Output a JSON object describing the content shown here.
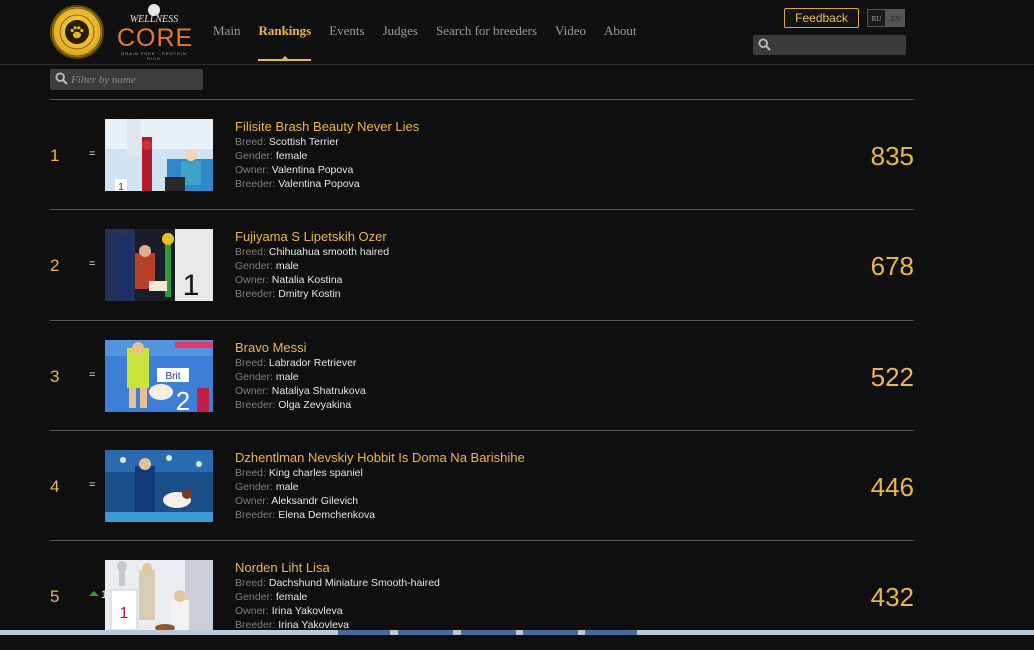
{
  "header": {
    "logo_best_dog_text": "BEST RUSSIAN DOG",
    "logo_wellness_text": "WELLNESS",
    "logo_core_text": "CORE",
    "logo_core_sub": "GRAIN FREE · PROTEIN RICH",
    "nav": [
      {
        "label": "Main",
        "active": false
      },
      {
        "label": "Rankings",
        "active": true
      },
      {
        "label": "Events",
        "active": false
      },
      {
        "label": "Judges",
        "active": false
      },
      {
        "label": "Search for breeders",
        "active": false
      },
      {
        "label": "Video",
        "active": false
      },
      {
        "label": "About",
        "active": false
      }
    ],
    "feedback_label": "Feedback",
    "lang_ru": "RU",
    "lang_en": "EN",
    "search_placeholder": ""
  },
  "filter": {
    "placeholder": "Filter by name"
  },
  "labels": {
    "breed": "Breed:",
    "gender": "Gender:",
    "owner": "Owner:",
    "breeder": "Breeder:"
  },
  "rankings": [
    {
      "rank": "1",
      "change": "=",
      "change_dir": "same",
      "name": "Filisite Brash Beauty Never Lies",
      "breed": "Scottish Terrier",
      "gender": "female",
      "owner": "Valentina Popova",
      "breeder": "Valentina Popova",
      "score": "835"
    },
    {
      "rank": "2",
      "change": "=",
      "change_dir": "same",
      "name": "Fujiyama S Lipetskih Ozer",
      "breed": "Chihuahua smooth haired",
      "gender": "male",
      "owner": "Natalia Kostina",
      "breeder": "Dmitry Kostin",
      "score": "678"
    },
    {
      "rank": "3",
      "change": "=",
      "change_dir": "same",
      "name": "Bravo Messi",
      "breed": "Labrador Retriever",
      "gender": "male",
      "owner": "Nataliya Shatrukova",
      "breeder": "Olga Zevyakina",
      "score": "522"
    },
    {
      "rank": "4",
      "change": "=",
      "change_dir": "same",
      "name": "Dzhentlman Nevskiy Hobbit Is Doma Na Barishihe",
      "breed": "King charles spaniel",
      "gender": "male",
      "owner": "Aleksandr Gilevich",
      "breeder": "Elena Demchenkova",
      "score": "446"
    },
    {
      "rank": "5",
      "change": "1",
      "change_dir": "up",
      "name": "Norden Liht Lisa",
      "breed": "Dachshund Miniature Smooth-haired",
      "gender": "female",
      "owner": "Irina Yakovleva",
      "breeder": "Irina Yakovleva",
      "score": "432"
    }
  ],
  "thumb_sign_1": "1",
  "thumb_sign_2": "1",
  "thumb_sign_3": "Brit",
  "thumb_sign_3b": "2",
  "thumb_sign_5": "1",
  "colors": {
    "accent": "#e9b84a",
    "background": "#0f0f0f",
    "label_gray": "#7e7e7e",
    "value_white": "#e6e6e6",
    "divider": "#555555"
  }
}
